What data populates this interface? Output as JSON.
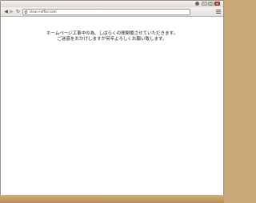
{
  "browser": {
    "address_bar": {
      "url": "clean-reffior.com"
    }
  },
  "page": {
    "message_line1": "ホームページ工事中の為、しばらくの間閉鎖させていただきます。",
    "message_line2": "ご迷惑をおかけしますが何卒よろしくお願い致します。"
  },
  "icons": {
    "back": "back-arrow-icon",
    "forward": "forward-arrow-icon",
    "reload": "reload-icon",
    "page": "page-icon",
    "menu": "menu-icon",
    "profile": "profile-icon",
    "minimize": "minimize-icon",
    "maximize": "maximize-icon",
    "close": "close-icon"
  }
}
